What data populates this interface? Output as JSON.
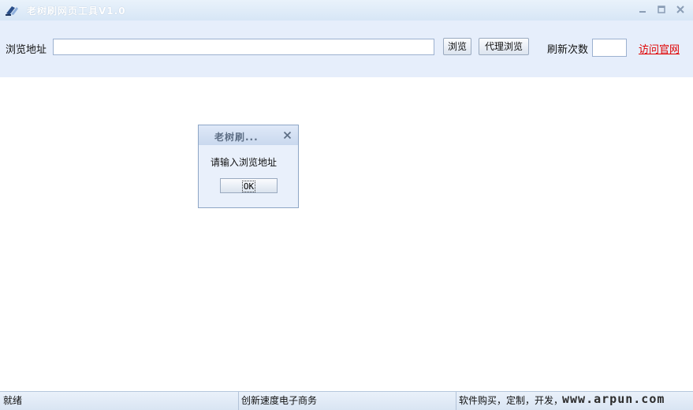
{
  "window": {
    "title": "老树刷网页工具V1.0"
  },
  "toolbar": {
    "url_label": "浏览地址",
    "url_value": "",
    "browse_label": "浏览",
    "proxy_browse_label": "代理浏览",
    "refresh_count_label": "刷新次数",
    "refresh_count_value": "",
    "visit_site_label": "访问官网"
  },
  "dialog": {
    "title": "老树刷...",
    "message": "请输入浏览地址",
    "ok_label": "OK"
  },
  "statusbar": {
    "status": "就绪",
    "company": "创新速度电子商务",
    "service": "软件购买，定制，开发，",
    "watermark": "www.arpun.com"
  },
  "colors": {
    "link": "#e00000",
    "toolbar_bg": "#e6eefb"
  }
}
